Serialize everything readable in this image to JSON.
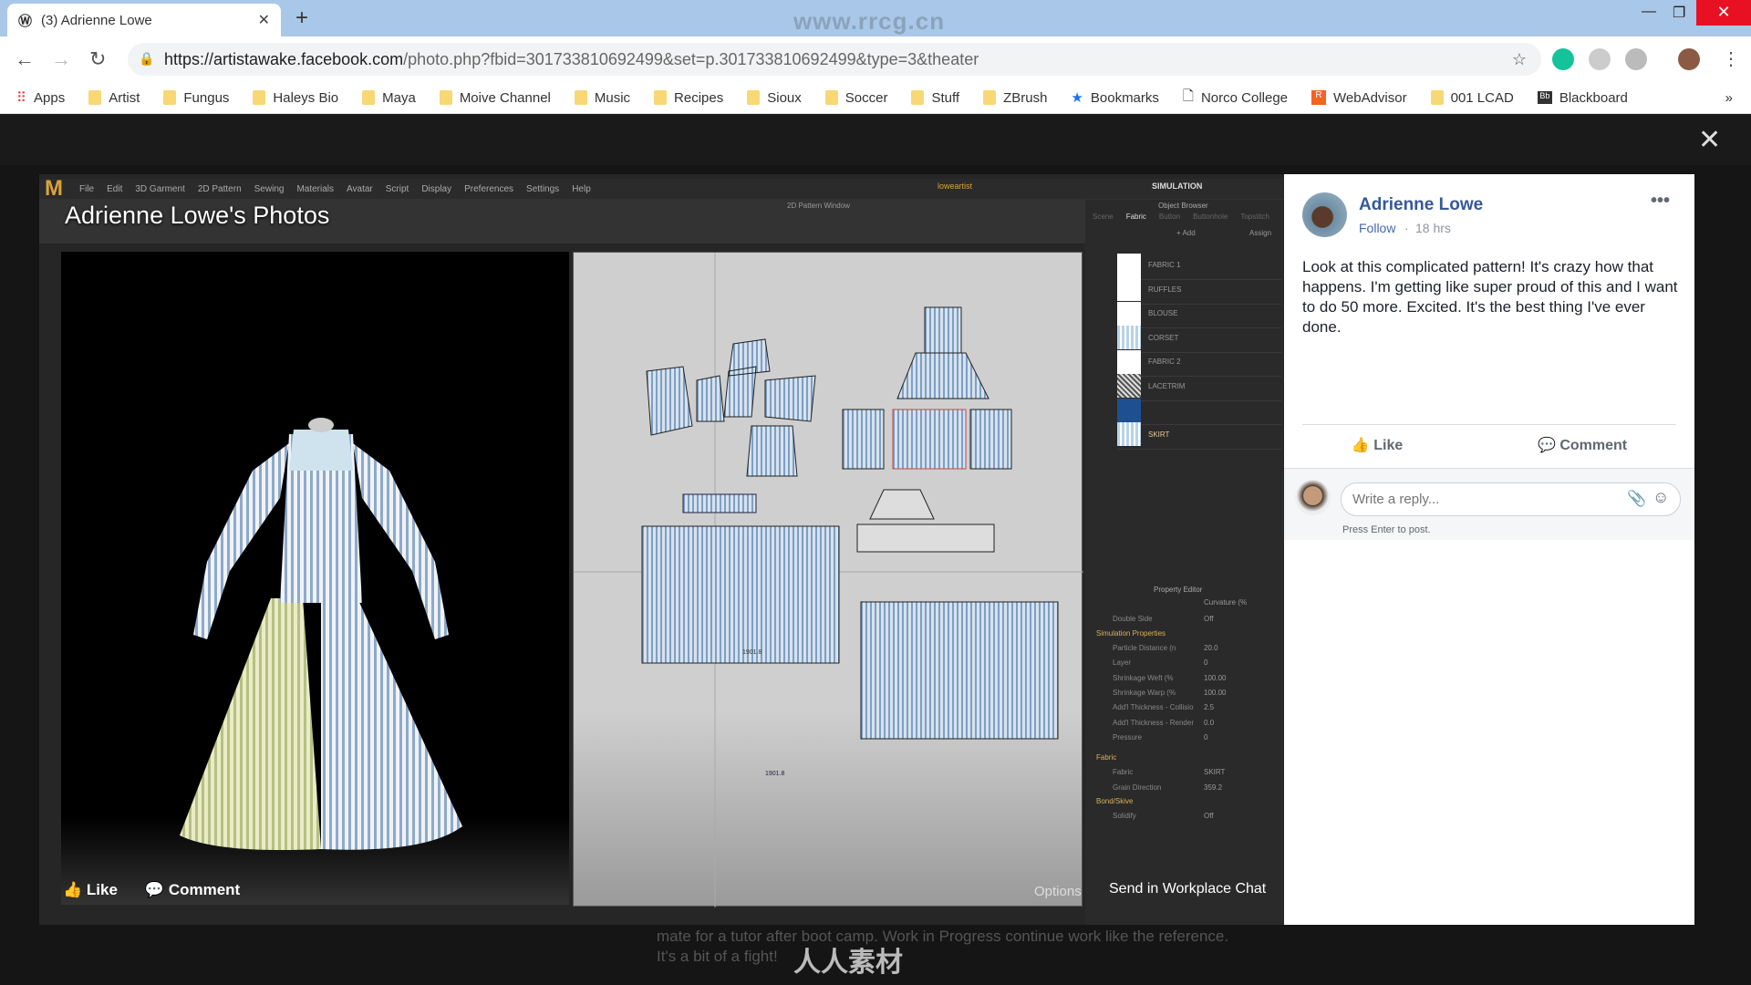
{
  "browser": {
    "tab_title": "(3) Adrienne Lowe",
    "url_host": "https://artistawake.facebook.com",
    "url_path": "/photo.php?fbid=301733810692499&set=p.301733810692499&type=3&theater",
    "watermark": "www.rrcg.cn",
    "bookmarks": [
      {
        "label": "Apps",
        "icon": "apps-grid-icon"
      },
      {
        "label": "Artist",
        "icon": "folder-icon"
      },
      {
        "label": "Fungus",
        "icon": "folder-icon"
      },
      {
        "label": "Haleys Bio",
        "icon": "folder-icon"
      },
      {
        "label": "Maya",
        "icon": "folder-icon"
      },
      {
        "label": "Moive Channel",
        "icon": "folder-icon"
      },
      {
        "label": "Music",
        "icon": "folder-icon"
      },
      {
        "label": "Recipes",
        "icon": "folder-icon"
      },
      {
        "label": "Sioux",
        "icon": "folder-icon"
      },
      {
        "label": "Soccer",
        "icon": "folder-icon"
      },
      {
        "label": "Stuff",
        "icon": "folder-icon"
      },
      {
        "label": "ZBrush",
        "icon": "folder-icon"
      },
      {
        "label": "Bookmarks",
        "icon": "star-icon"
      },
      {
        "label": "Norco College",
        "icon": "page-icon"
      },
      {
        "label": "WebAdvisor",
        "icon": "webadvisor-icon"
      },
      {
        "label": "001 LCAD",
        "icon": "folder-icon"
      },
      {
        "label": "Blackboard",
        "icon": "blackboard-icon"
      }
    ],
    "more": "»"
  },
  "photo": {
    "title": "Adrienne Lowe's Photos",
    "like": "Like",
    "comment": "Comment",
    "options": "Options",
    "send_chat": "Send in Workplace Chat",
    "app": {
      "menu": [
        "File",
        "Edit",
        "3D Garment",
        "2D Pattern",
        "Sewing",
        "Materials",
        "Avatar",
        "Script",
        "Display",
        "Preferences",
        "Settings",
        "Help"
      ],
      "user": "loweartist",
      "mode": "SIMULATION",
      "window_2d": "2D Pattern Window",
      "object_browser": "Object Browser",
      "browser_tabs": [
        "Scene",
        "Fabric",
        "Button",
        "Buttonhole",
        "Topstitch"
      ],
      "add": "+ Add",
      "assign": "Assign",
      "fabrics": [
        {
          "name": "FABRIC 1",
          "swatch": "white"
        },
        {
          "name": "RUFFLES",
          "swatch": "white"
        },
        {
          "name": "BLOUSE",
          "swatch": "white"
        },
        {
          "name": "CORSET",
          "swatch": "stripe"
        },
        {
          "name": "FABRIC 2",
          "swatch": "white"
        },
        {
          "name": "LACETRIM",
          "swatch": "lace"
        },
        {
          "name": "",
          "swatch": "blue"
        },
        {
          "name": "SKIRT",
          "swatch": "stripe"
        }
      ],
      "property_editor": "Property Editor",
      "pattern_labels": [
        "1901.8",
        "1901.8"
      ],
      "props": {
        "curvature": "Curvature (%",
        "double_side": "Double Side",
        "double_side_val": "Off",
        "sim_section": "Simulation Properties",
        "rows": [
          [
            "Particle Distance (n",
            "20.0"
          ],
          [
            "Layer",
            "0"
          ],
          [
            "Shrinkage Weft (%",
            "100.00"
          ],
          [
            "Shrinkage Warp (%",
            "100.00"
          ],
          [
            "Add'l Thickness - Collisio",
            "2.5"
          ],
          [
            "Add'l Thickness - Render",
            "0.0"
          ],
          [
            "Pressure",
            "0"
          ]
        ],
        "fabric_section": "Fabric",
        "fabric_label": "Fabric",
        "fabric_val": "SKIRT",
        "grain": "Grain Direction",
        "grain_val": "359.2",
        "bond": "Bond/Skive",
        "solidify": "Solidify",
        "solidify_val": "Off"
      }
    }
  },
  "post": {
    "author": "Adrienne Lowe",
    "follow": "Follow",
    "time": "18 hrs",
    "text": "Look at this complicated pattern! It's crazy how that happens. I'm getting like super proud of this and I want to do 50 more. Excited. It's the best thing I've ever done.",
    "like": "Like",
    "comment": "Comment",
    "reply_placeholder": "Write a reply...",
    "press_enter": "Press Enter to post."
  },
  "background_text": "mate    for a tutor    after boot camp. Work in Progress    continue work    like the reference. It's a bit of a fight!",
  "brand_watermark": "人人素材"
}
